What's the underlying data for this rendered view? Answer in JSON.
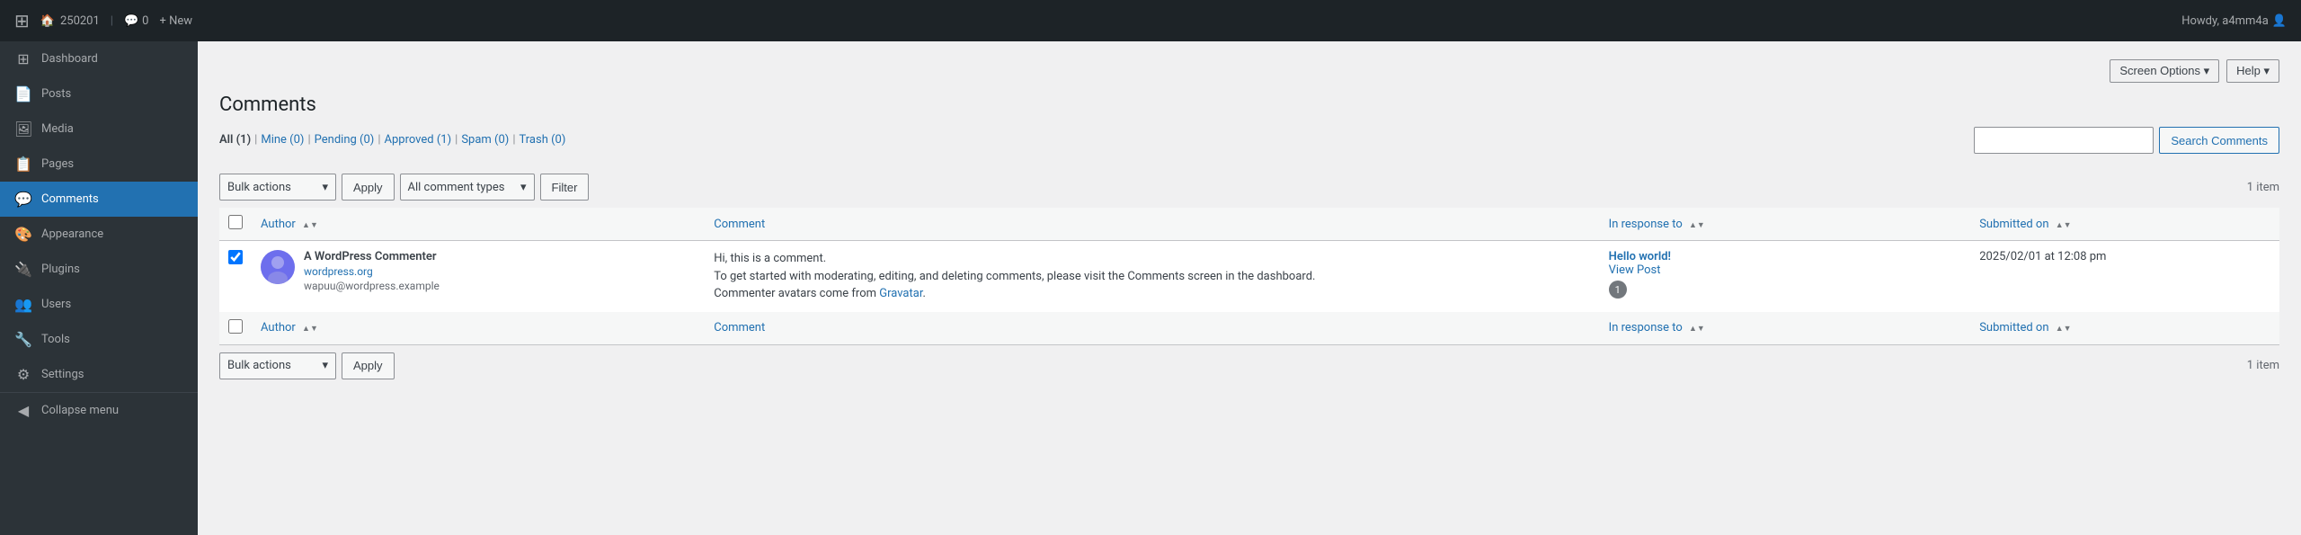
{
  "adminBar": {
    "logo": "⚙",
    "siteName": "250201",
    "commentsIcon": "💬",
    "commentsCount": "0",
    "newLabel": "+ New",
    "howdy": "Howdy, a4mm4a",
    "userIcon": "👤"
  },
  "screenOptions": {
    "label": "Screen Options ▾"
  },
  "help": {
    "label": "Help ▾"
  },
  "sidebar": {
    "items": [
      {
        "id": "dashboard",
        "icon": "⊞",
        "label": "Dashboard"
      },
      {
        "id": "posts",
        "icon": "📄",
        "label": "Posts"
      },
      {
        "id": "media",
        "icon": "🖼",
        "label": "Media"
      },
      {
        "id": "pages",
        "icon": "📋",
        "label": "Pages"
      },
      {
        "id": "comments",
        "icon": "💬",
        "label": "Comments",
        "active": true
      },
      {
        "id": "appearance",
        "icon": "🎨",
        "label": "Appearance"
      },
      {
        "id": "plugins",
        "icon": "🔌",
        "label": "Plugins"
      },
      {
        "id": "users",
        "icon": "👥",
        "label": "Users"
      },
      {
        "id": "tools",
        "icon": "🔧",
        "label": "Tools"
      },
      {
        "id": "settings",
        "icon": "⚙",
        "label": "Settings"
      }
    ],
    "collapse": "Collapse menu"
  },
  "page": {
    "title": "Comments",
    "filterLinks": [
      {
        "id": "all",
        "label": "All",
        "count": "(1)",
        "current": true
      },
      {
        "id": "mine",
        "label": "Mine",
        "count": "(0)"
      },
      {
        "id": "pending",
        "label": "Pending",
        "count": "(0)"
      },
      {
        "id": "approved",
        "label": "Approved",
        "count": "(1)"
      },
      {
        "id": "spam",
        "label": "Spam",
        "count": "(0)"
      },
      {
        "id": "trash",
        "label": "Trash",
        "count": "(0)"
      }
    ],
    "itemCount": "1 item",
    "searchPlaceholder": "",
    "searchButton": "Search Comments"
  },
  "toolbar": {
    "bulkActions": "Bulk actions",
    "applyButton": "Apply",
    "filterType": "All comment types",
    "filterButton": "Filter"
  },
  "table": {
    "headers": {
      "author": "Author",
      "comment": "Comment",
      "inResponseTo": "In response to",
      "submittedOn": "Submitted on"
    },
    "rows": [
      {
        "id": "row1",
        "authorName": "A WordPress Commenter",
        "authorUrl": "wordpress.org",
        "authorEmail": "wapuu@wordpress.example",
        "commentLines": [
          "Hi, this is a comment.",
          "To get started with moderating, editing, and deleting comments, please visit the Comments screen in the dashboard.",
          "Commenter avatars come from Gravatar."
        ],
        "gravatarLinkText": "Gravatar",
        "responseTitle": "Hello world!",
        "responseLink": "View Post",
        "responseBadge": "1",
        "submittedDate": "2025/02/01 at 12:08 pm"
      }
    ]
  },
  "bottomToolbar": {
    "bulkActions": "Bulk actions",
    "applyButton": "Apply",
    "itemCount": "1 item"
  }
}
